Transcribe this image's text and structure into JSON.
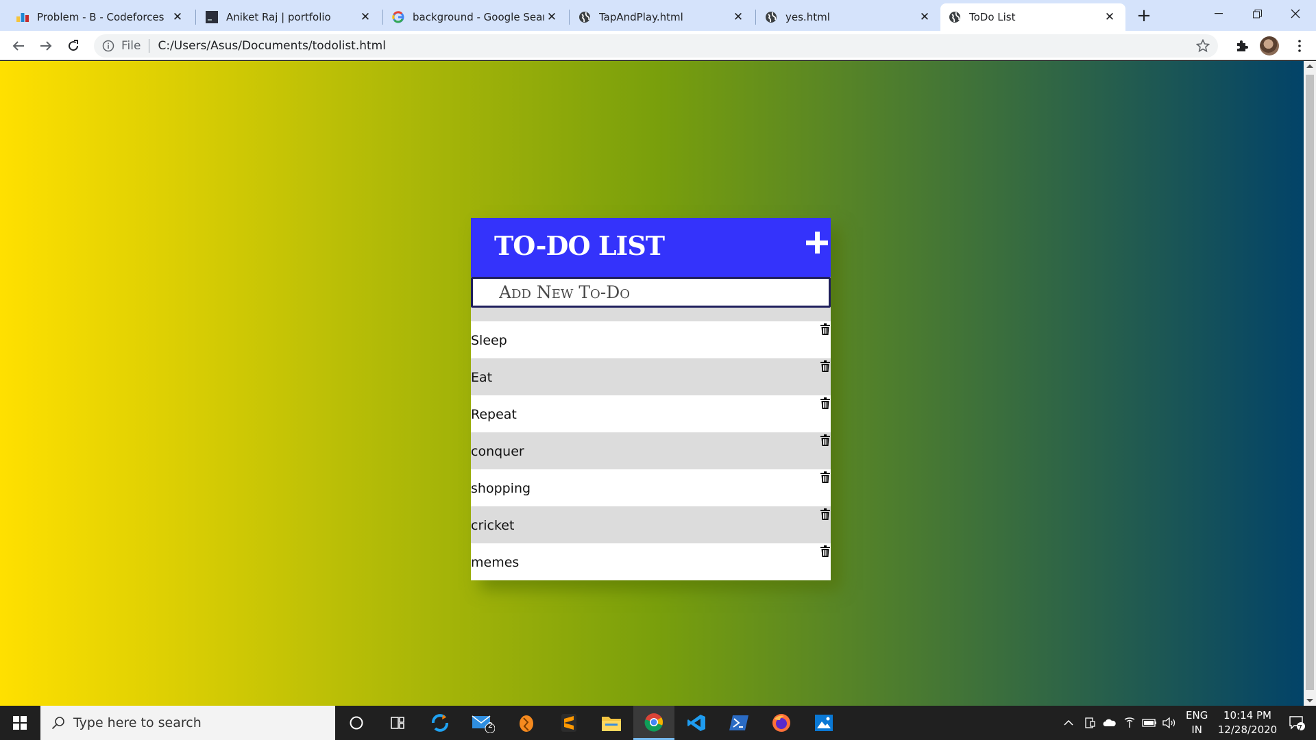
{
  "browser": {
    "tabs": [
      {
        "title": "Problem - B - Codeforces",
        "icon": "codeforces-icon"
      },
      {
        "title": "Aniket Raj | portfolio",
        "icon": "portfolio-icon"
      },
      {
        "title": "background - Google Search",
        "icon": "google-icon"
      },
      {
        "title": "TapAndPlay.html",
        "icon": "globe-icon"
      },
      {
        "title": "yes.html",
        "icon": "globe-icon"
      },
      {
        "title": "ToDo List",
        "icon": "globe-icon",
        "active": true
      }
    ],
    "address": {
      "scheme": "File",
      "path": "C:/Users/Asus/Documents/todolist.html"
    }
  },
  "page": {
    "background_colors": [
      "#ffe000",
      "#799f0c",
      "#00416a"
    ],
    "todo": {
      "title": "To-Do List",
      "input_placeholder": "Add New To-Do",
      "header_color": "#3433fb",
      "items": [
        "Sleep",
        "Eat",
        "Repeat",
        "conquer",
        "shopping",
        "cricket",
        "memes"
      ]
    }
  },
  "taskbar": {
    "search_placeholder": "Type here to search",
    "mail_badge": "2",
    "language": "ENG",
    "region": "IN",
    "time": "10:14 PM",
    "date": "12/28/2020",
    "notifications": "7"
  }
}
